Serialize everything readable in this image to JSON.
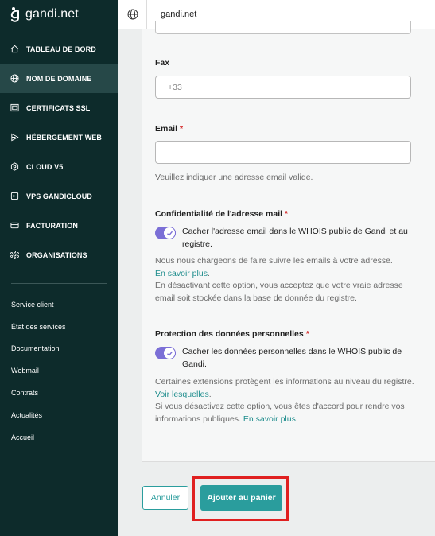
{
  "brand": {
    "name": "gandi.net"
  },
  "sidebar": {
    "nav": [
      {
        "label": "TABLEAU DE BORD",
        "icon": "home-icon"
      },
      {
        "label": "NOM DE DOMAINE",
        "icon": "globe-icon",
        "active": true
      },
      {
        "label": "CERTIFICATS SSL",
        "icon": "certificate-icon"
      },
      {
        "label": "HÉBERGEMENT WEB",
        "icon": "web-hosting-icon"
      },
      {
        "label": "CLOUD V5",
        "icon": "cloud-icon"
      },
      {
        "label": "VPS GANDICLOUD",
        "icon": "vps-icon"
      },
      {
        "label": "FACTURATION",
        "icon": "credit-card-icon"
      },
      {
        "label": "ORGANISATIONS",
        "icon": "organisation-icon"
      }
    ],
    "links": [
      "Service client",
      "État des services",
      "Documentation",
      "Webmail",
      "Contrats",
      "Actualités",
      "Accueil"
    ]
  },
  "topbar": {
    "title": "gandi.net",
    "icon": "globe-icon"
  },
  "form": {
    "fax": {
      "label": "Fax",
      "placeholder": "+33"
    },
    "email": {
      "label": "Email",
      "required": "*",
      "value": "",
      "help": "Veuillez indiquer une adresse email valide."
    },
    "email_privacy": {
      "label": "Confidentialité de l'adresse mail",
      "required": "*",
      "toggle_text": "Cacher l'adresse email dans le WHOIS public de Gandi et au registre.",
      "help_1": "Nous nous chargeons de faire suivre les emails à votre adresse.",
      "help_link": "En savoir plus",
      "help_2": "En désactivant cette option, vous acceptez que votre vraie adresse email soit stockée dans la base de donnée du registre."
    },
    "data_protection": {
      "label": "Protection des données personnelles",
      "required": "*",
      "toggle_text": "Cacher les données personnelles dans le WHOIS public de Gandi.",
      "help_1": "Certaines extensions protègent les informations au niveau du registre.",
      "help_link_1": "Voir lesquelles",
      "help_2": "Si vous désactivez cette option, vous êtes d'accord pour rendre vos informations publiques.",
      "help_link_2": "En savoir plus"
    }
  },
  "actions": {
    "cancel": "Annuler",
    "add_to_cart": "Ajouter au panier"
  },
  "colors": {
    "sidebar_bg": "#0d2b2b",
    "accent": "#2a9d9d",
    "toggle": "#7b6fd6",
    "highlight": "#e02020",
    "required": "#d42a2a"
  }
}
